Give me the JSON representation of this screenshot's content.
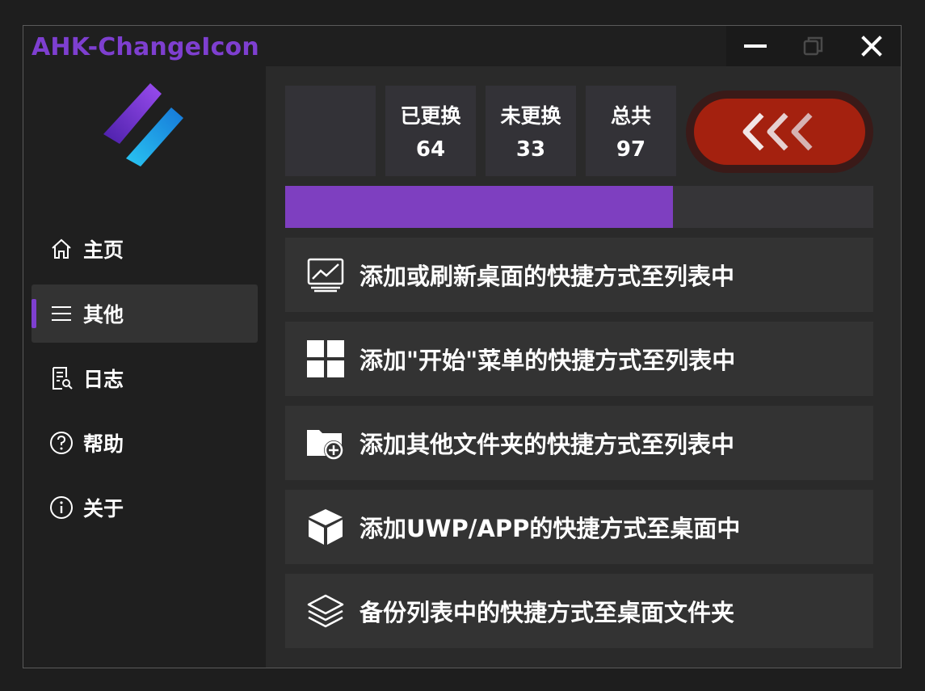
{
  "window": {
    "title": "AHK-ChangeIcon"
  },
  "titlebar_controls": [
    "minimize-icon",
    "restore-icon",
    "close-icon"
  ],
  "sidebar": {
    "items": [
      {
        "label": "主页",
        "icon": "home-icon",
        "active": false
      },
      {
        "label": "其他",
        "icon": "menu-lines-icon",
        "active": true
      },
      {
        "label": "日志",
        "icon": "log-search-icon",
        "active": false
      },
      {
        "label": "帮助",
        "icon": "help-circle-icon",
        "active": false
      },
      {
        "label": "关于",
        "icon": "info-circle-icon",
        "active": false
      }
    ]
  },
  "stats": [
    {
      "label": "已更换",
      "value": "64"
    },
    {
      "label": "未更换",
      "value": "33"
    },
    {
      "label": "总共",
      "value": "97"
    }
  ],
  "progress": {
    "fraction": 0.66
  },
  "actions": [
    {
      "label": "添加或刷新桌面的快捷方式至列表中",
      "icon": "desktop-chart-icon"
    },
    {
      "label": "添加\"开始\"菜单的快捷方式至列表中",
      "icon": "windows-start-icon"
    },
    {
      "label": "添加其他文件夹的快捷方式至列表中",
      "icon": "folder-add-icon"
    },
    {
      "label": "添加UWP/APP的快捷方式至桌面中",
      "icon": "cube-icon"
    },
    {
      "label": "备份列表中的快捷方式至桌面文件夹",
      "icon": "layers-icon"
    }
  ],
  "colors": {
    "accent": "#7e3fd0",
    "back_button": "#a4210f",
    "background": "#1f1f1f",
    "panel": "#2a2a2a"
  }
}
